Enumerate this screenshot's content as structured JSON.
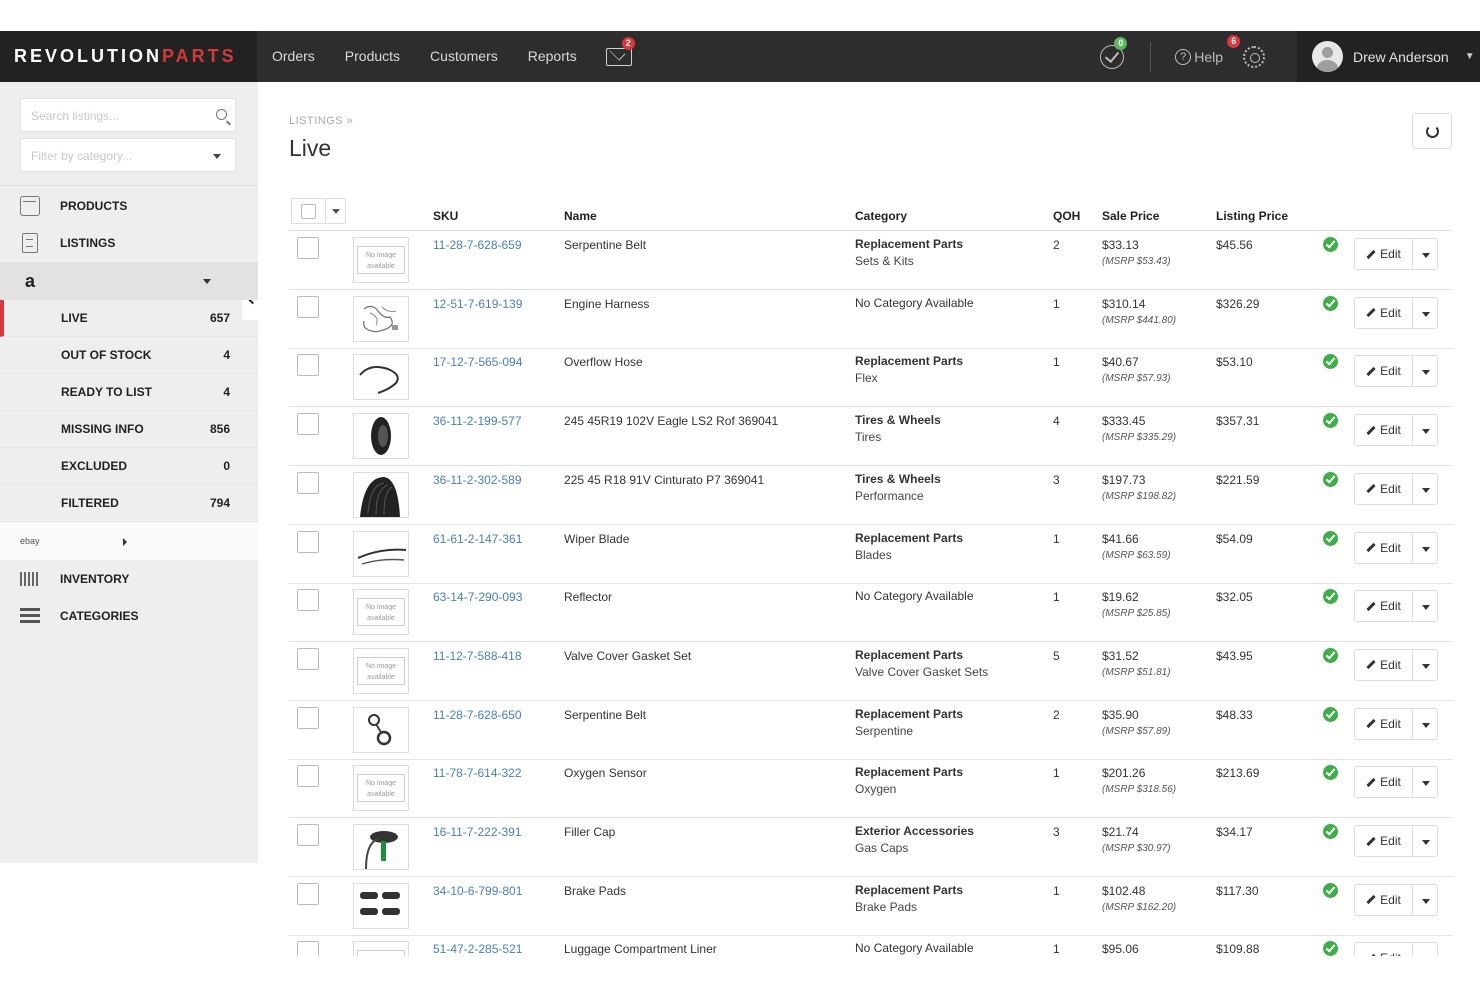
{
  "brand": {
    "part1": "REVOLUTION",
    "part2": "PARTS"
  },
  "nav": {
    "items": [
      "Orders",
      "Products",
      "Customers",
      "Reports"
    ],
    "mail_badge": "2",
    "check_badge": "0",
    "help_label": "Help",
    "help_badge": "6",
    "user_name": "Drew Anderson"
  },
  "sidebar": {
    "search_placeholder": "Search listings...",
    "filter_placeholder": "Filter by category...",
    "products_label": "PRODUCTS",
    "listings_label": "LISTINGS",
    "amazon_label": "a",
    "sub_items": [
      {
        "label": "LIVE",
        "count": "657"
      },
      {
        "label": "OUT OF STOCK",
        "count": "4"
      },
      {
        "label": "READY TO LIST",
        "count": "4"
      },
      {
        "label": "MISSING INFO",
        "count": "856"
      },
      {
        "label": "EXCLUDED",
        "count": "0"
      },
      {
        "label": "FILTERED",
        "count": "794"
      }
    ],
    "ebay_label": "ebay",
    "inventory_label": "INVENTORY",
    "categories_label": "CATEGORIES"
  },
  "main": {
    "breadcrumb": "LISTINGS »",
    "title": "Live",
    "columns": {
      "sku": "SKU",
      "name": "Name",
      "category": "Category",
      "qoh": "QOH",
      "sale": "Sale Price",
      "listing": "Listing Price"
    },
    "edit_label": "Edit",
    "no_image_label": "No image available",
    "rows": [
      {
        "sku": "11-28-7-628-659",
        "name": "Serpentine Belt",
        "cat": "Replacement Parts",
        "subcat": "Sets & Kits",
        "qoh": "2",
        "sale": "$33.13",
        "msrp": "(MSRP $53.43)",
        "list": "$45.56",
        "img": "none"
      },
      {
        "sku": "12-51-7-619-139",
        "name": "Engine Harness",
        "cat": "No Category Available",
        "subcat": "",
        "qoh": "1",
        "sale": "$310.14",
        "msrp": "(MSRP $441.80)",
        "list": "$326.29",
        "img": "harness"
      },
      {
        "sku": "17-12-7-565-094",
        "name": "Overflow Hose",
        "cat": "Replacement Parts",
        "subcat": "Flex",
        "qoh": "1",
        "sale": "$40.67",
        "msrp": "(MSRP $57.93)",
        "list": "$53.10",
        "img": "hose"
      },
      {
        "sku": "36-11-2-199-577",
        "name": "245 45R19 102V Eagle LS2 Rof 369041",
        "cat": "Tires & Wheels",
        "subcat": "Tires",
        "qoh": "4",
        "sale": "$333.45",
        "msrp": "(MSRP $335.29)",
        "list": "$357.31",
        "img": "tire"
      },
      {
        "sku": "36-11-2-302-589",
        "name": "225 45 R18 91V Cinturato P7 369041",
        "cat": "Tires & Wheels",
        "subcat": "Performance",
        "qoh": "3",
        "sale": "$197.73",
        "msrp": "(MSRP $198.82)",
        "list": "$221.59",
        "img": "tread"
      },
      {
        "sku": "61-61-2-147-361",
        "name": "Wiper Blade",
        "cat": "Replacement Parts",
        "subcat": "Blades",
        "qoh": "1",
        "sale": "$41.66",
        "msrp": "(MSRP $63.59)",
        "list": "$54.09",
        "img": "wiper"
      },
      {
        "sku": "63-14-7-290-093",
        "name": "Reflector",
        "cat": "No Category Available",
        "subcat": "",
        "qoh": "1",
        "sale": "$19.62",
        "msrp": "(MSRP $25.85)",
        "list": "$32.05",
        "img": "none"
      },
      {
        "sku": "11-12-7-588-418",
        "name": "Valve Cover Gasket Set",
        "cat": "Replacement Parts",
        "subcat": "Valve Cover Gasket Sets",
        "qoh": "5",
        "sale": "$31.52",
        "msrp": "(MSRP $51.81)",
        "list": "$43.95",
        "img": "none"
      },
      {
        "sku": "11-28-7-628-650",
        "name": "Serpentine Belt",
        "cat": "Replacement Parts",
        "subcat": "Serpentine",
        "qoh": "2",
        "sale": "$35.90",
        "msrp": "(MSRP $57.89)",
        "list": "$48.33",
        "img": "pulley"
      },
      {
        "sku": "11-78-7-614-322",
        "name": "Oxygen Sensor",
        "cat": "Replacement Parts",
        "subcat": "Oxygen",
        "qoh": "1",
        "sale": "$201.26",
        "msrp": "(MSRP $318.56)",
        "list": "$213.69",
        "img": "none"
      },
      {
        "sku": "16-11-7-222-391",
        "name": "Filler Cap",
        "cat": "Exterior Accessories",
        "subcat": "Gas Caps",
        "qoh": "3",
        "sale": "$21.74",
        "msrp": "(MSRP $30.97)",
        "list": "$34.17",
        "img": "cap"
      },
      {
        "sku": "34-10-6-799-801",
        "name": "Brake Pads",
        "cat": "Replacement Parts",
        "subcat": "Brake Pads",
        "qoh": "1",
        "sale": "$102.48",
        "msrp": "(MSRP $162.20)",
        "list": "$117.30",
        "img": "pads"
      },
      {
        "sku": "51-47-2-285-521",
        "name": "Luggage Compartment Liner",
        "cat": "No Category Available",
        "subcat": "",
        "qoh": "1",
        "sale": "$95.06",
        "msrp": "",
        "list": "$109.88",
        "img": "none"
      }
    ]
  }
}
